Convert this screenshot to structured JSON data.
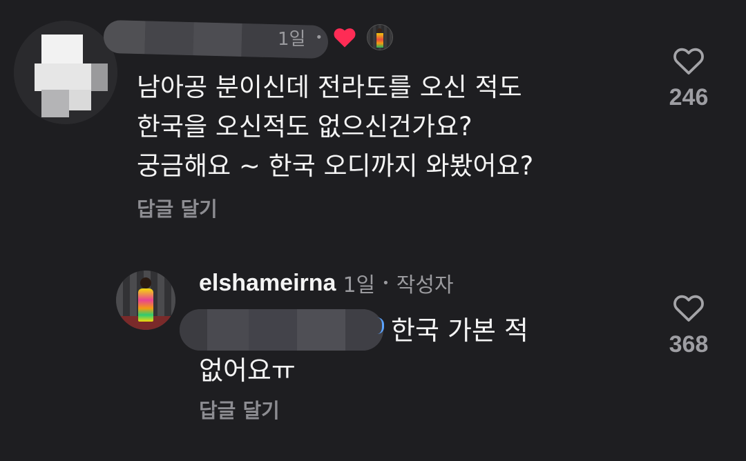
{
  "comment1": {
    "time": "1일",
    "text_lines": [
      "남아공 분이신데 전라도를 오신 적도",
      "한국을 오신적도 없으신건가요?",
      "궁금해요 ~ 한국 오디까지 와봤어요?"
    ],
    "reply_label": "답글 달기",
    "likes": "246",
    "creator_liked": true
  },
  "comment2": {
    "username": "elshameirna",
    "time": "1일",
    "author_badge": "작성자",
    "text_line1": "한국 가본 적",
    "text_line2": "없어요ㅠ",
    "reply_label": "답글 달기",
    "likes": "368"
  },
  "separator": "•",
  "colors": {
    "background": "#1e1e21",
    "heart_liked": "#fe2c55",
    "mention": "#5aa3ff",
    "muted_text": "#9a9a9e"
  },
  "icons": [
    "heart-outline-icon",
    "heart-filled-icon"
  ]
}
